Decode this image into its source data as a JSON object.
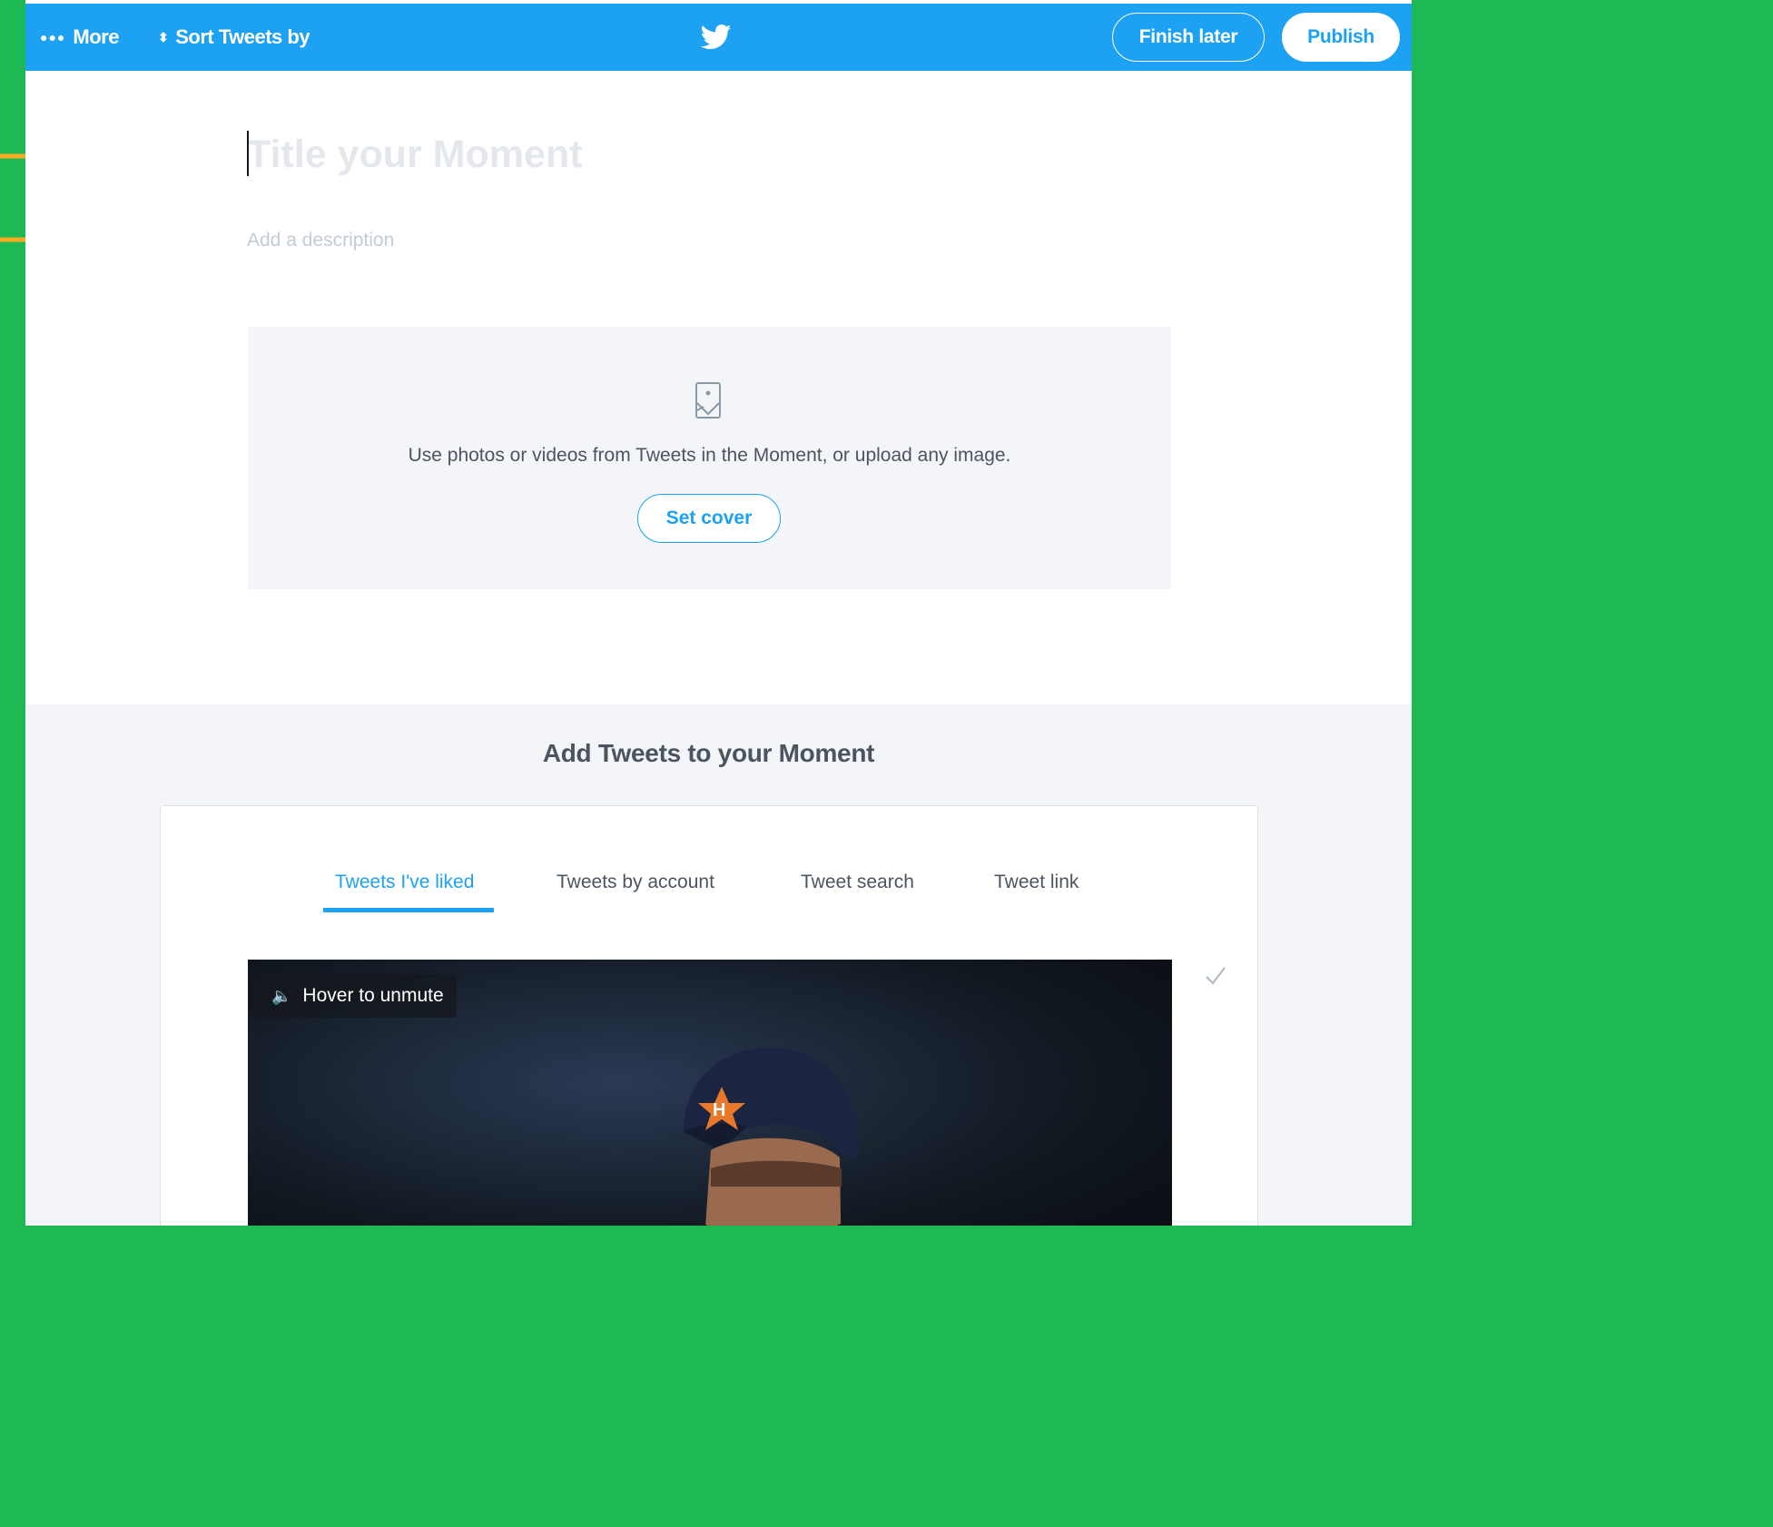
{
  "topbar": {
    "more_label": "More",
    "sort_label": "Sort Tweets by",
    "finish_later_label": "Finish later",
    "publish_label": "Publish",
    "brand_color": "#1da1f2"
  },
  "moment": {
    "title_placeholder": "Title your Moment",
    "description_placeholder": "Add a description"
  },
  "cover": {
    "text": "Use photos or videos from Tweets in the Moment, or upload any image.",
    "button_label": "Set cover",
    "icon": "image-icon"
  },
  "add_tweets": {
    "title": "Add Tweets to your Moment",
    "tabs": [
      {
        "label": "Tweets I've liked",
        "active": true
      },
      {
        "label": "Tweets by account",
        "active": false
      },
      {
        "label": "Tweet search",
        "active": false
      },
      {
        "label": "Tweet link",
        "active": false
      }
    ],
    "video": {
      "mute_label": "Hover to unmute"
    }
  },
  "annotation": {
    "arrow_color": "#fbab23",
    "background_color": "#1db954"
  }
}
